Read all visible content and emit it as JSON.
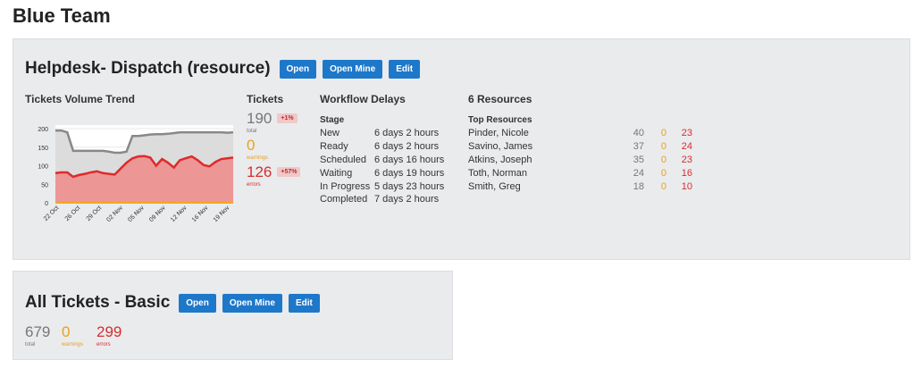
{
  "page_title": "Blue Team",
  "panel1": {
    "title": "Helpdesk- Dispatch (resource)",
    "buttons": {
      "open": "Open",
      "open_mine": "Open Mine",
      "edit": "Edit"
    },
    "trend_title": "Tickets Volume Trend",
    "tickets_title": "Tickets",
    "total": {
      "value": "190",
      "badge": "+1%",
      "label": "total"
    },
    "warnings": {
      "value": "0",
      "label": "warnings"
    },
    "errors": {
      "value": "126",
      "badge": "+57%",
      "label": "errors"
    },
    "workflow": {
      "title": "Workflow Delays",
      "header": "Stage",
      "rows": [
        {
          "stage": "New",
          "delay": "6 days 2 hours"
        },
        {
          "stage": "Ready",
          "delay": "6 days 2 hours"
        },
        {
          "stage": "Scheduled",
          "delay": "6 days 16 hours"
        },
        {
          "stage": "Waiting",
          "delay": "6 days 19 hours"
        },
        {
          "stage": "In Progress",
          "delay": "5 days 23 hours"
        },
        {
          "stage": "Completed",
          "delay": "7 days 2 hours"
        }
      ]
    },
    "resources": {
      "title": "6 Resources",
      "header": "Top Resources",
      "rows": [
        {
          "name": "Pinder, Nicole",
          "total": "40",
          "warnings": "0",
          "errors": "23"
        },
        {
          "name": "Savino, James",
          "total": "37",
          "warnings": "0",
          "errors": "24"
        },
        {
          "name": "Atkins, Joseph",
          "total": "35",
          "warnings": "0",
          "errors": "23"
        },
        {
          "name": "Toth, Norman",
          "total": "24",
          "warnings": "0",
          "errors": "16"
        },
        {
          "name": "Smith, Greg",
          "total": "18",
          "warnings": "0",
          "errors": "10"
        }
      ]
    }
  },
  "panel2": {
    "title": "All Tickets - Basic",
    "buttons": {
      "open": "Open",
      "open_mine": "Open Mine",
      "edit": "Edit"
    },
    "total": {
      "value": "679",
      "label": "total"
    },
    "warnings": {
      "value": "0",
      "label": "warnings"
    },
    "errors": {
      "value": "299",
      "label": "errors"
    }
  },
  "colors": {
    "accent": "#1e78c9",
    "total": "#777777",
    "warnings": "#e7a21b",
    "errors": "#d62d2d"
  },
  "chart_data": {
    "type": "area",
    "ylim": [
      0,
      200
    ],
    "yticks": [
      "0",
      "50",
      "100",
      "150",
      "200"
    ],
    "xticks": [
      "22 Oct",
      "26 Oct",
      "29 Oct",
      "02 Nov",
      "05 Nov",
      "09 Nov",
      "12 Nov",
      "16 Nov",
      "19 Nov"
    ],
    "x": [
      "20 Oct",
      "21 Oct",
      "22 Oct",
      "23 Oct",
      "24 Oct",
      "25 Oct",
      "26 Oct",
      "27 Oct",
      "28 Oct",
      "29 Oct",
      "30 Oct",
      "31 Oct",
      "01 Nov",
      "02 Nov",
      "03 Nov",
      "04 Nov",
      "05 Nov",
      "06 Nov",
      "07 Nov",
      "08 Nov",
      "09 Nov",
      "10 Nov",
      "11 Nov",
      "12 Nov",
      "13 Nov",
      "14 Nov",
      "15 Nov",
      "16 Nov",
      "17 Nov",
      "18 Nov",
      "19 Nov"
    ],
    "series": [
      {
        "color": "#888888",
        "values": [
          195,
          195,
          190,
          140,
          140,
          140,
          140,
          140,
          140,
          138,
          135,
          135,
          138,
          180,
          180,
          182,
          184,
          185,
          185,
          186,
          188,
          190,
          190,
          190,
          190,
          190,
          190,
          190,
          190,
          189,
          190
        ]
      },
      {
        "color": "#dd2b2b",
        "values": [
          80,
          82,
          82,
          70,
          75,
          78,
          82,
          85,
          80,
          78,
          76,
          92,
          108,
          120,
          125,
          126,
          122,
          100,
          118,
          108,
          95,
          115,
          120,
          125,
          115,
          102,
          98,
          110,
          118,
          120,
          122
        ]
      },
      {
        "color": "#f5a623",
        "values": [
          0,
          0,
          0,
          0,
          0,
          0,
          0,
          0,
          0,
          0,
          0,
          0,
          0,
          0,
          0,
          0,
          0,
          0,
          0,
          0,
          0,
          0,
          0,
          0,
          0,
          0,
          0,
          0,
          0,
          0,
          0
        ]
      }
    ]
  }
}
